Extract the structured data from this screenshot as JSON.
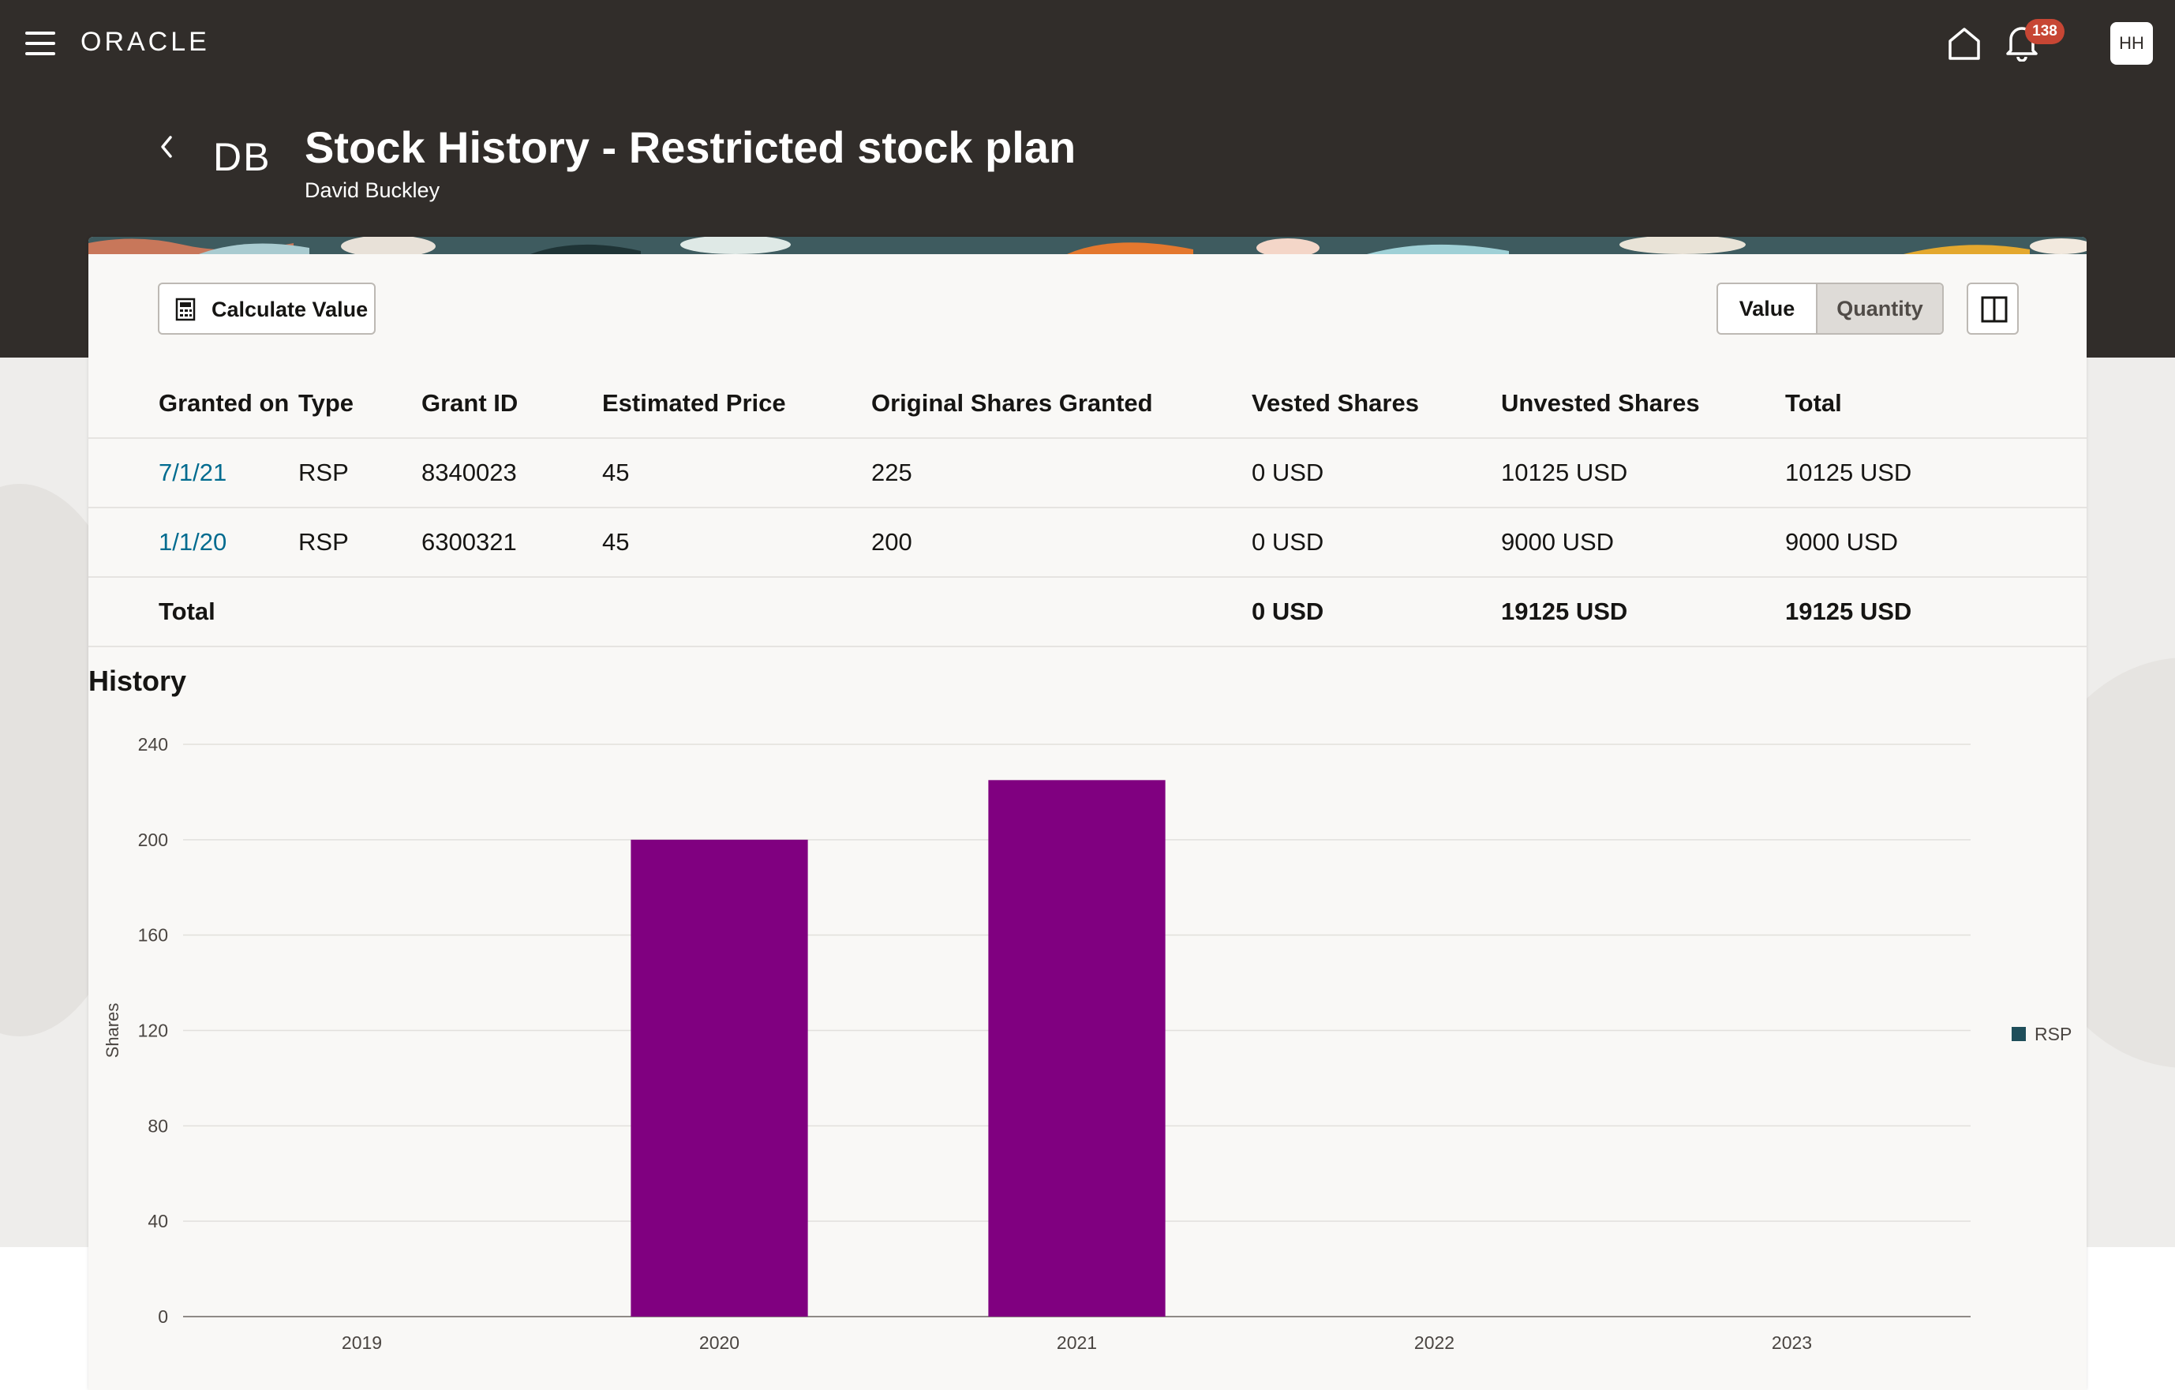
{
  "header": {
    "brand": "ORACLE",
    "notification_count": "138",
    "user_initials": "HH"
  },
  "page": {
    "employee_initials": "DB",
    "title": "Stock History - Restricted stock plan",
    "subtitle": "David Buckley"
  },
  "toolbar": {
    "calculate_label": "Calculate Value",
    "view_toggle": [
      {
        "label": "Value",
        "selected": false
      },
      {
        "label": "Quantity",
        "selected": true
      }
    ]
  },
  "table": {
    "columns": [
      "Granted on",
      "Type",
      "Grant ID",
      "Estimated Price",
      "Original Shares Granted",
      "Vested Shares",
      "Unvested Shares",
      "Total"
    ],
    "rows": [
      {
        "granted_on": "7/1/21",
        "type": "RSP",
        "grant_id": "8340023",
        "estimated_price": "45",
        "original_shares": "225",
        "vested": "0 USD",
        "unvested": "10125 USD",
        "total": "10125 USD"
      },
      {
        "granted_on": "1/1/20",
        "type": "RSP",
        "grant_id": "6300321",
        "estimated_price": "45",
        "original_shares": "200",
        "vested": "0 USD",
        "unvested": "9000 USD",
        "total": "9000 USD"
      }
    ],
    "total_row": {
      "label": "Total",
      "vested": "0 USD",
      "unvested": "19125 USD",
      "total": "19125 USD"
    }
  },
  "history": {
    "title": "History"
  },
  "colors": {
    "header_bg": "#312d2a",
    "bar_color": "#800080",
    "legend_swatch": "#1f4e5a",
    "link": "#006b8f",
    "badge": "#c74634"
  },
  "chart_data": {
    "type": "bar",
    "categories": [
      "2019",
      "2020",
      "2021",
      "2022",
      "2023"
    ],
    "series": [
      {
        "name": "RSP",
        "values": [
          0,
          200,
          225,
          0,
          0
        ]
      }
    ],
    "xlabel": "",
    "ylabel": "Shares",
    "ylim": [
      0,
      240
    ],
    "yticks": [
      0,
      40,
      80,
      160,
      120,
      200,
      240
    ],
    "grid": true,
    "legend": "right"
  }
}
